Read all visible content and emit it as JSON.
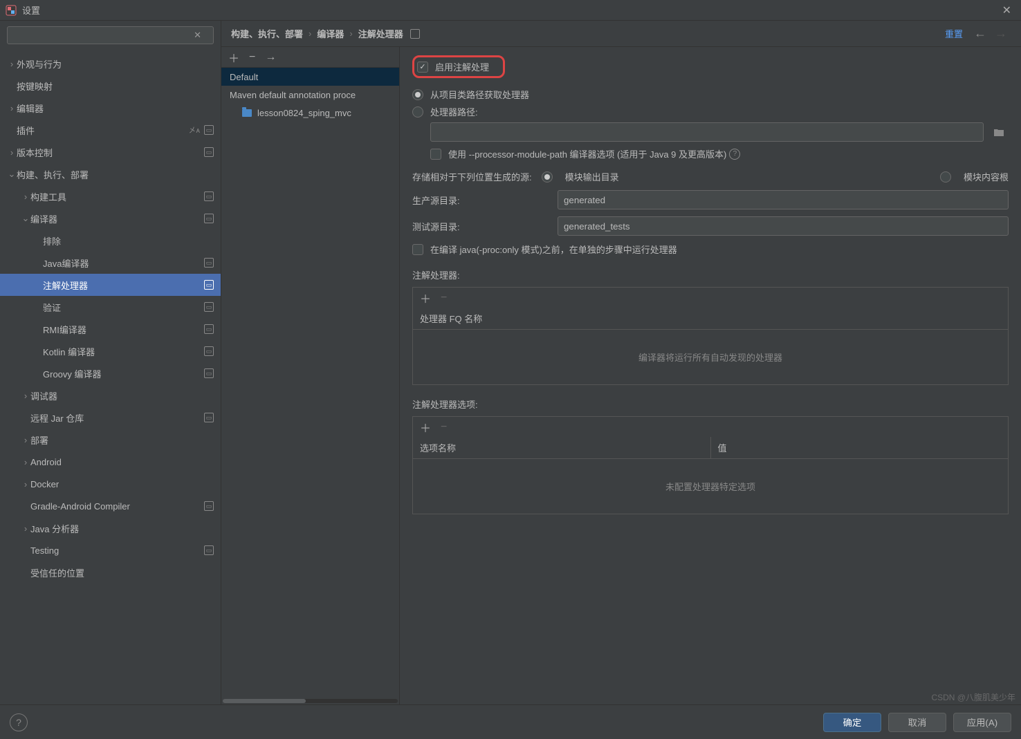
{
  "window": {
    "title": "设置"
  },
  "breadcrumbs": {
    "a": "构建、执行、部署",
    "b": "编译器",
    "c": "注解处理器",
    "reset": "重置"
  },
  "profiles": {
    "default": "Default",
    "maven": "Maven default annotation proce",
    "module": "lesson0824_sping_mvc"
  },
  "settings": {
    "enable": "启用注解处理",
    "fromClasspath": "从项目类路径获取处理器",
    "processorPath": "处理器路径:",
    "useModulePath": "使用 --processor-module-path 编译器选项 (适用于 Java 9 及更高版本)",
    "storeRel": "存储相对于下列位置生成的源:",
    "moduleOutput": "模块输出目录",
    "moduleContent": "模块内容根",
    "prodDir": "生产源目录:",
    "prodVal": "generated",
    "testDir": "测试源目录:",
    "testVal": "generated_tests",
    "runSeparate": "在编译 java(-proc:only 模式)之前，在单独的步骤中运行处理器",
    "procSection": "注解处理器:",
    "procHeader": "处理器 FQ 名称",
    "procEmpty": "编译器将运行所有自动发现的处理器",
    "optSection": "注解处理器选项:",
    "optName": "选项名称",
    "optValue": "值",
    "optEmpty": "未配置处理器特定选项"
  },
  "tree": {
    "appearance": "外观与行为",
    "keymap": "按键映射",
    "editor": "编辑器",
    "plugins": "插件",
    "vcs": "版本控制",
    "build": "构建、执行、部署",
    "buildTools": "构建工具",
    "compiler": "编译器",
    "exclude": "排除",
    "javaCompiler": "Java编译器",
    "annotation": "注解处理器",
    "validation": "验证",
    "rmi": "RMI编译器",
    "kotlin": "Kotlin 编译器",
    "groovy": "Groovy 编译器",
    "debugger": "调试器",
    "remoteJar": "远程 Jar 仓库",
    "deploy": "部署",
    "android": "Android",
    "docker": "Docker",
    "gradleAndroid": "Gradle-Android Compiler",
    "javaAnalyzer": "Java 分析器",
    "testing": "Testing",
    "trusted": "受信任的位置"
  },
  "footer": {
    "ok": "确定",
    "cancel": "取消",
    "apply": "应用(A)"
  },
  "watermark": "CSDN @八腹肌美少年"
}
